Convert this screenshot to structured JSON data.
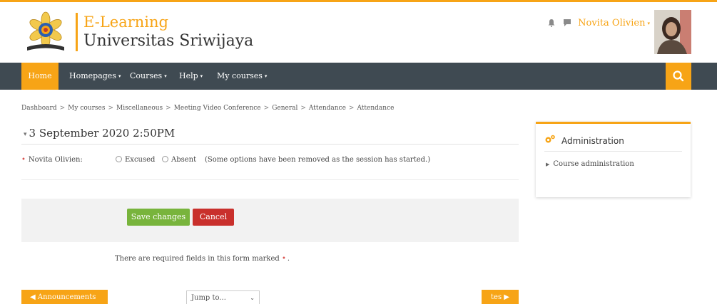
{
  "brand": {
    "line1": "E-Learning",
    "line2": "Universitas Sriwijaya",
    "accent_color": "#f7a416"
  },
  "header": {
    "user_name": "Novita Olivien",
    "icons": [
      "bell-icon",
      "chat-icon",
      "user-avatar"
    ]
  },
  "nav": {
    "items": [
      "Home",
      "Homepages",
      "Courses",
      "Help",
      "My courses"
    ],
    "search_icon": "search-icon",
    "bar_color": "#3f4a52"
  },
  "breadcrumb": [
    "Dashboard",
    "My courses",
    "Miscellaneous",
    "Meeting Video Conference",
    "General",
    "Attendance",
    "Attendance"
  ],
  "session": {
    "title": "3 September 2020 2:50PM"
  },
  "form": {
    "field_label": "Novita Olivien:",
    "options": [
      "Excused",
      "Absent"
    ],
    "note": "(Some options have been removed as the session has started.)",
    "save_label": "Save changes",
    "cancel_label": "Cancel",
    "required_text": "There are required fields in this form marked",
    "required_suffix": "."
  },
  "footer_nav": {
    "prev_label": "◀ Announcements",
    "jump_placeholder": "Jump to...",
    "next_label": "tes ▶"
  },
  "admin": {
    "title": "Administration",
    "item": "Course administration"
  }
}
